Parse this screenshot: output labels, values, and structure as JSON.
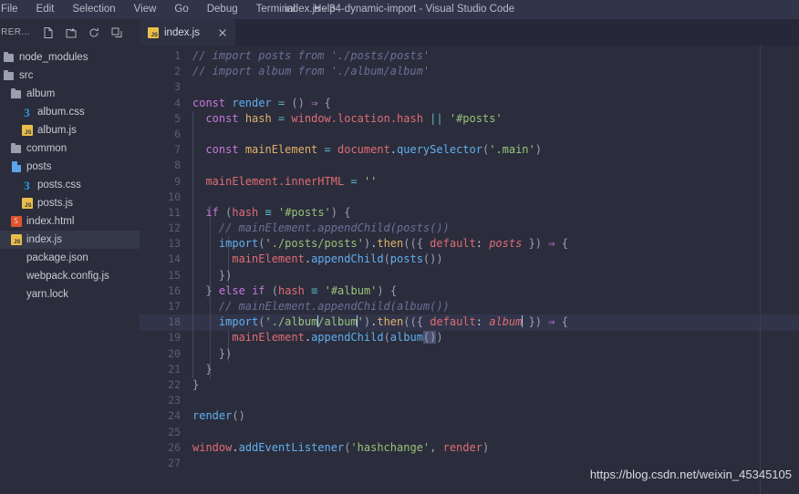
{
  "window": {
    "title": "index.js - 34-dynamic-import - Visual Studio Code"
  },
  "menu": {
    "items": [
      {
        "label": "File"
      },
      {
        "label": "Edit"
      },
      {
        "label": "Selection"
      },
      {
        "label": "View"
      },
      {
        "label": "Go"
      },
      {
        "label": "Debug"
      },
      {
        "label": "Terminal"
      },
      {
        "label": "Help"
      }
    ]
  },
  "sidebar": {
    "title": "PRER...",
    "actions": [
      {
        "name": "new-file-icon"
      },
      {
        "name": "new-folder-icon"
      },
      {
        "name": "refresh-icon"
      },
      {
        "name": "collapse-all-icon"
      }
    ],
    "items": [
      {
        "label": "node_modules",
        "icon": "folder-icon",
        "depth": 0,
        "selected": false
      },
      {
        "label": "src",
        "icon": "folder-icon",
        "depth": 0,
        "selected": false
      },
      {
        "label": "album",
        "icon": "folder-icon",
        "depth": 1,
        "selected": false
      },
      {
        "label": "album.css",
        "icon": "css-icon",
        "depth": 2,
        "selected": false
      },
      {
        "label": "album.js",
        "icon": "js-icon",
        "depth": 2,
        "selected": false
      },
      {
        "label": "common",
        "icon": "folder-icon",
        "depth": 1,
        "selected": false
      },
      {
        "label": "posts",
        "icon": "document-icon",
        "depth": 1,
        "selected": false
      },
      {
        "label": "posts.css",
        "icon": "css-icon",
        "depth": 2,
        "selected": false
      },
      {
        "label": "posts.js",
        "icon": "js-icon",
        "depth": 2,
        "selected": false
      },
      {
        "label": "index.html",
        "icon": "html-icon",
        "depth": 1,
        "selected": false
      },
      {
        "label": "index.js",
        "icon": "js-icon",
        "depth": 1,
        "selected": true
      },
      {
        "label": "package.json",
        "icon": "none-icon",
        "depth": 1,
        "selected": false
      },
      {
        "label": "webpack.config.js",
        "icon": "none-icon",
        "depth": 1,
        "selected": false
      },
      {
        "label": "yarn.lock",
        "icon": "none-icon",
        "depth": 1,
        "selected": false
      }
    ]
  },
  "tabs": [
    {
      "label": "index.js",
      "icon": "js-icon",
      "active": true,
      "close": "×"
    }
  ],
  "editor": {
    "active_line": 18,
    "lines": [
      {
        "n": "1",
        "text": "// import posts from './posts/posts'"
      },
      {
        "n": "2",
        "text": "// import album from './album/album'"
      },
      {
        "n": "3",
        "text": ""
      },
      {
        "n": "4",
        "text": "const render = () => {"
      },
      {
        "n": "5",
        "text": "  const hash = window.location.hash || '#posts'"
      },
      {
        "n": "6",
        "text": ""
      },
      {
        "n": "7",
        "text": "  const mainElement = document.querySelector('.main')"
      },
      {
        "n": "8",
        "text": ""
      },
      {
        "n": "9",
        "text": "  mainElement.innerHTML = ''"
      },
      {
        "n": "10",
        "text": ""
      },
      {
        "n": "11",
        "text": "  if (hash === '#posts') {"
      },
      {
        "n": "12",
        "text": "    // mainElement.appendChild(posts())"
      },
      {
        "n": "13",
        "text": "    import('./posts/posts').then(({ default: posts }) => {"
      },
      {
        "n": "14",
        "text": "      mainElement.appendChild(posts())"
      },
      {
        "n": "15",
        "text": "    })"
      },
      {
        "n": "16",
        "text": "  } else if (hash === '#album') {"
      },
      {
        "n": "17",
        "text": "    // mainElement.appendChild(album())"
      },
      {
        "n": "18",
        "text": "    import('./album/album').then(({ default: album }) => {"
      },
      {
        "n": "19",
        "text": "      mainElement.appendChild(album())"
      },
      {
        "n": "20",
        "text": "    })"
      },
      {
        "n": "21",
        "text": "  }"
      },
      {
        "n": "22",
        "text": "}"
      },
      {
        "n": "23",
        "text": ""
      },
      {
        "n": "24",
        "text": "render()"
      },
      {
        "n": "25",
        "text": ""
      },
      {
        "n": "26",
        "text": "window.addEventListener('hashchange', render)"
      },
      {
        "n": "27",
        "text": ""
      }
    ]
  },
  "watermark": {
    "text": "https://blog.csdn.net/weixin_45345105"
  },
  "colors": {
    "titlebar_bg": "#32344a",
    "sidebar_bg": "#2b2d3c",
    "editor_bg": "#2b2d3c",
    "tabbar_bg": "#26283a",
    "active_tab_bg": "#2e3142",
    "selection_bg": "#353849",
    "current_line_bg": "#32354a",
    "keyword": "#c678dd",
    "string": "#98c379",
    "comment": "#697098",
    "function": "#61afef",
    "object": "#e06c75",
    "variable": "#e0b16a",
    "operator": "#56b6c2"
  }
}
